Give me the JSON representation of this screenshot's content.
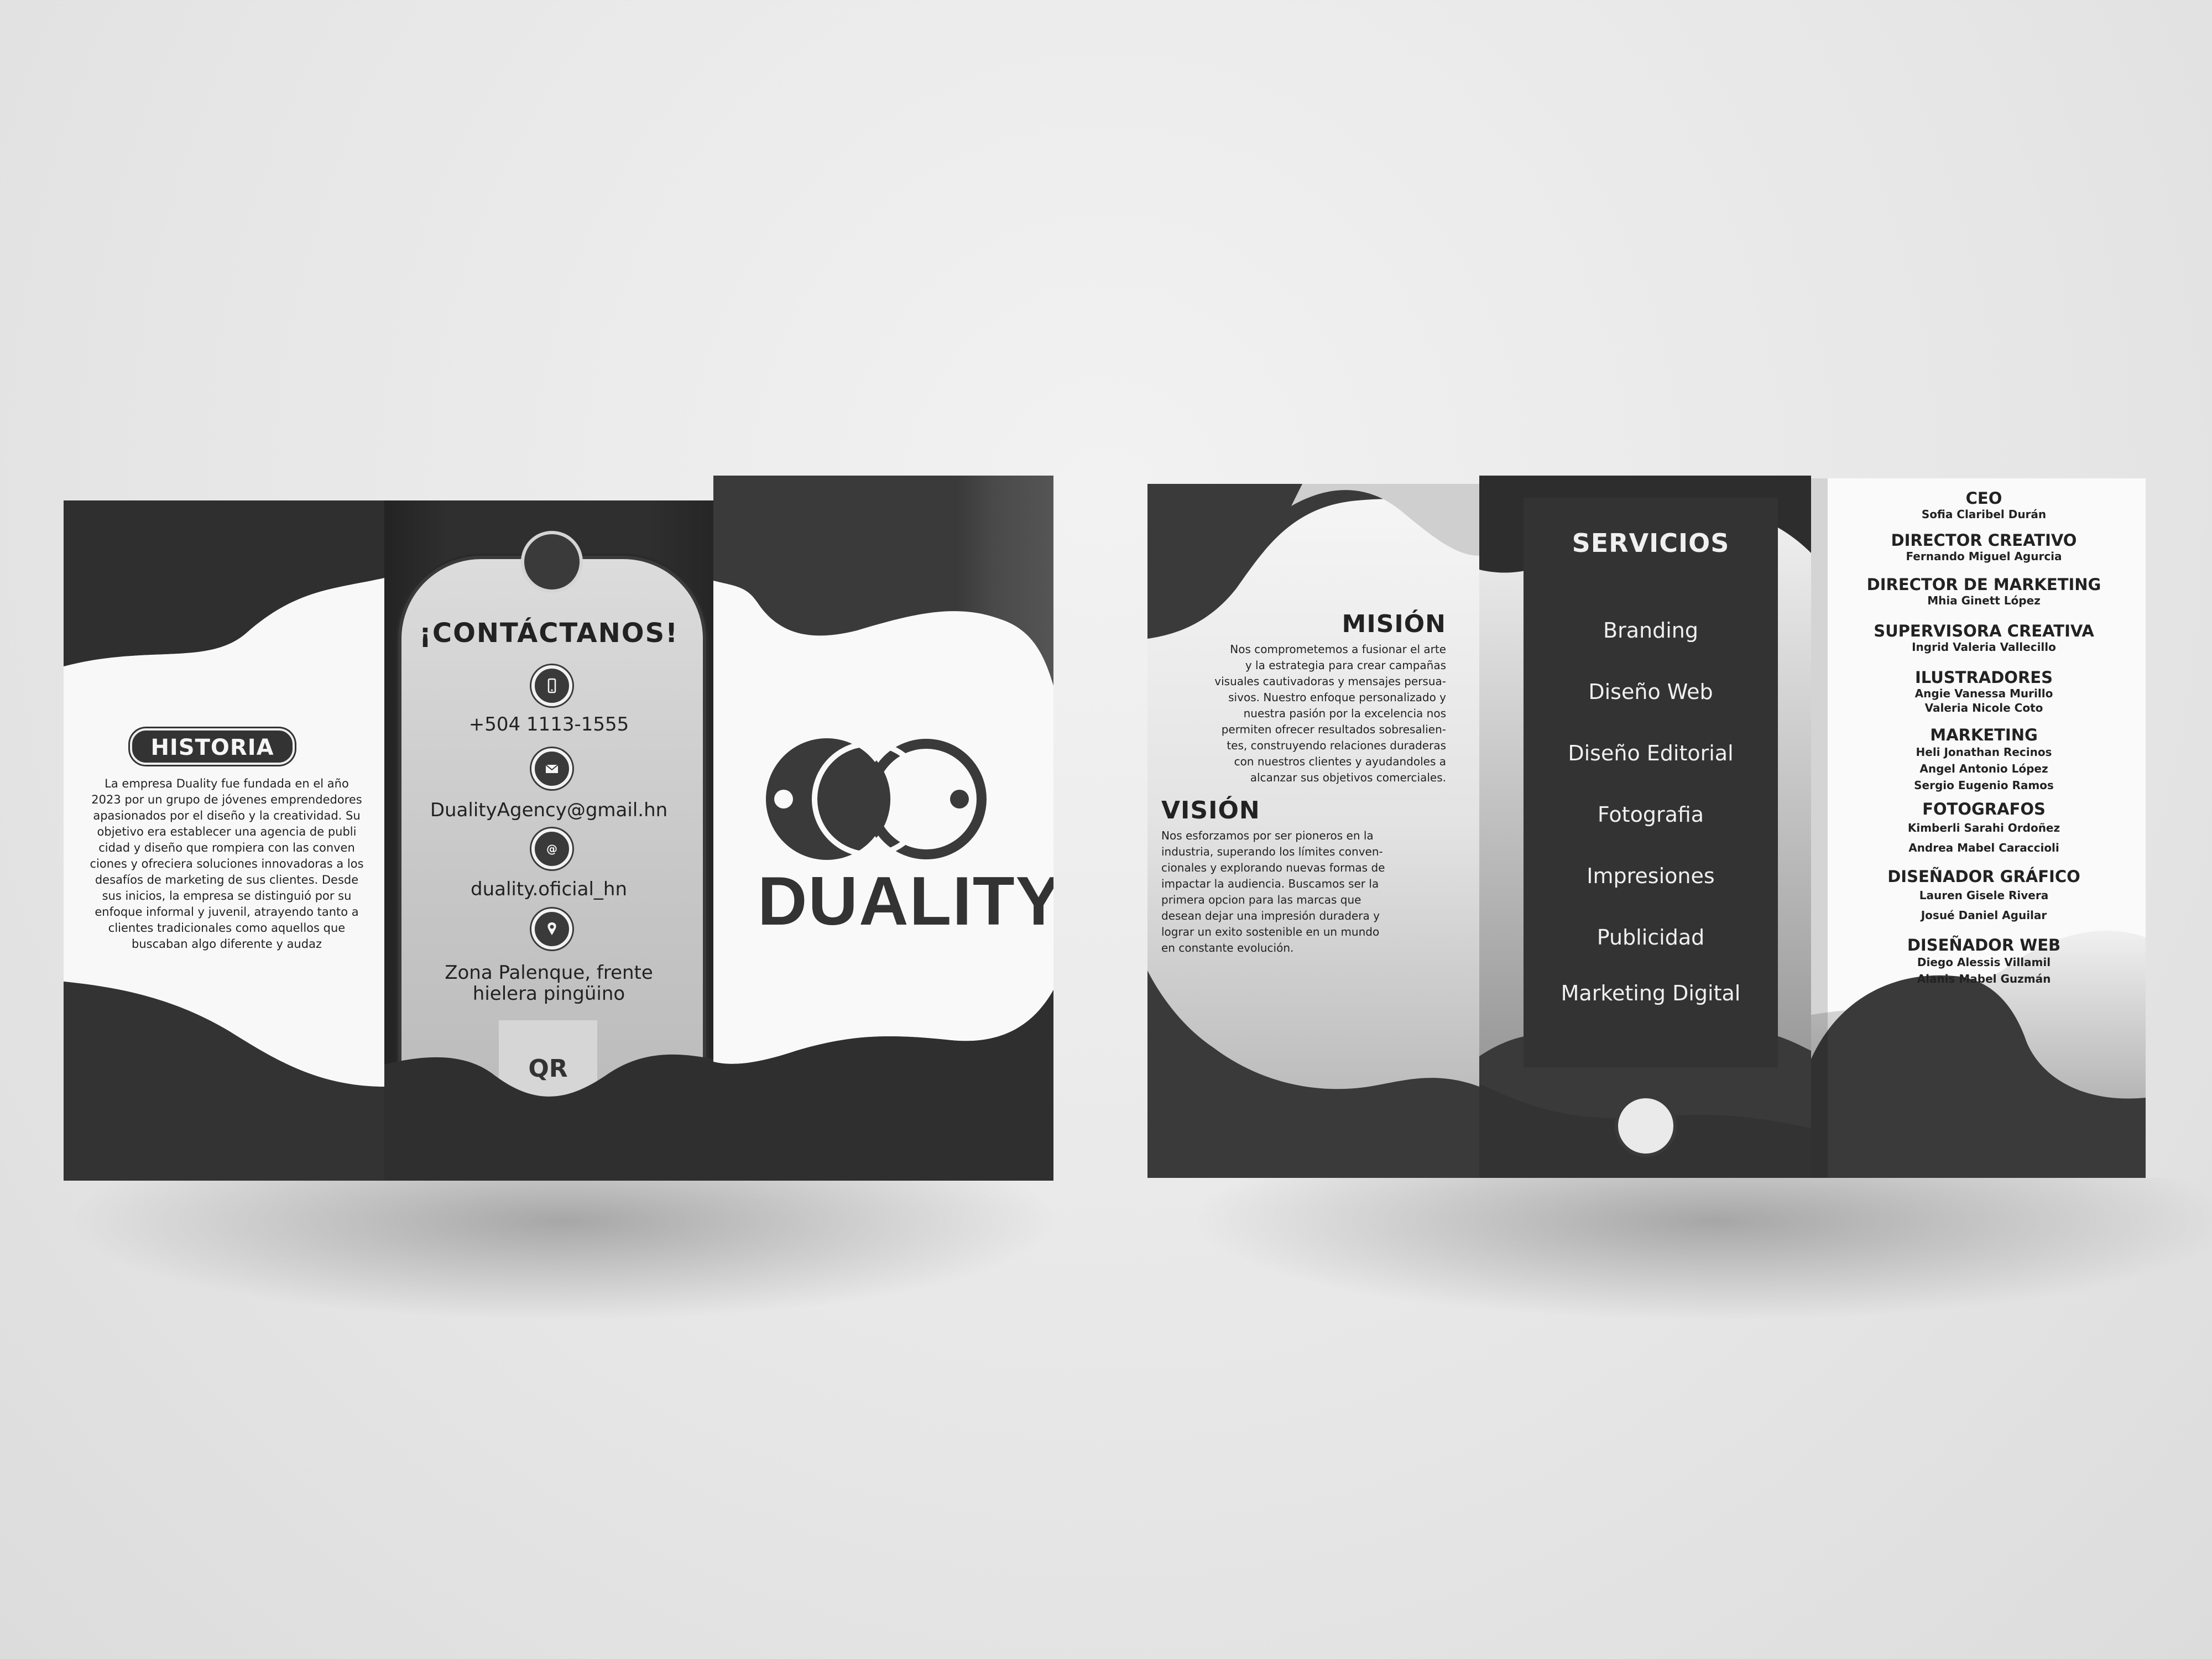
{
  "left_brochure": {
    "historia": {
      "title": "HISTORIA",
      "body_lines": [
        "La empresa Duality fue fundada en el año",
        "2023 por un grupo de jóvenes emprendedores",
        "apasionados por el diseño y la creatividad. Su",
        "objetivo era establecer una agencia de publi",
        "cidad y diseño que rompiera con las conven",
        "ciones y ofreciera soluciones innovadoras a los",
        "desafíos de marketing de sus clientes. Desde",
        "sus inicios, la empresa se distinguió por su",
        "enfoque informal y juvenil, atrayendo tanto a",
        "clientes tradicionales como aquellos que",
        "buscaban algo diferente y audaz"
      ]
    },
    "contact": {
      "title": "¡CONTÁCTANOS!",
      "phone": "+504 1113-1555",
      "email": "DualityAgency@gmail.hn",
      "social": "duality.oficial_hn",
      "address_line1": "Zona Palenque, frente",
      "address_line2": "hielera pingüino",
      "qr_label": "QR",
      "icons": [
        "phone-icon",
        "mail-icon",
        "at-icon",
        "location-pin-icon"
      ]
    },
    "brand": {
      "name": "DUALITY"
    }
  },
  "right_brochure": {
    "mision": {
      "title": "MISIÓN",
      "body_lines": [
        "Nos comprometemos a fusionar el arte",
        "y la estrategia para crear campañas",
        "visuales cautivadoras y mensajes persua-",
        "sivos. Nuestro enfoque personalizado y",
        "nuestra pasión por la excelencia nos",
        "permiten ofrecer resultados sobresalien-",
        "tes, construyendo relaciones duraderas",
        "con nuestros clientes y ayudandoles a",
        "alcanzar sus objetivos comerciales."
      ]
    },
    "vision": {
      "title": "VISIÓN",
      "body_lines": [
        "Nos esforzamos por ser pioneros en la",
        "industria, superando los límites conven-",
        "cionales y explorando nuevas formas de",
        "impactar la audiencia. Buscamos ser la",
        "primera opcion para las marcas que",
        "desean dejar una impresión duradera y",
        "lograr un exito sostenible en un mundo",
        "en constante evolución."
      ]
    },
    "servicios": {
      "title": "SERVICIOS",
      "items": [
        "Branding",
        "Diseño Web",
        "Diseño Editorial",
        "Fotografia",
        "Impresiones",
        "Publicidad",
        "Marketing Digital"
      ]
    },
    "team": [
      {
        "role": "CEO",
        "names": [
          "Sofia Claribel Durán"
        ]
      },
      {
        "role": "DIRECTOR CREATIVO",
        "names": [
          "Fernando Miguel Agurcia"
        ]
      },
      {
        "role": "DIRECTOR DE MARKETING",
        "names": [
          "Mhia Ginett López"
        ]
      },
      {
        "role": "SUPERVISORA CREATIVA",
        "names": [
          "Ingrid Valeria Vallecillo"
        ]
      },
      {
        "role": "ILUSTRADORES",
        "names": [
          "Angie Vanessa Murillo",
          "Valeria Nicole Coto"
        ]
      },
      {
        "role": "MARKETING",
        "names": [
          "Heli Jonathan Recinos",
          "Angel Antonio López",
          "Sergio Eugenio Ramos"
        ]
      },
      {
        "role": "FOTOGRAFOS",
        "names": [
          "Kimberli Sarahi Ordoñez",
          "Andrea Mabel Caraccioli"
        ]
      },
      {
        "role": "DISEÑADOR GRÁFICO",
        "names": [
          "Lauren Gisele Rivera",
          "Josué Daniel Aguilar"
        ]
      },
      {
        "role": "DISEÑADOR WEB",
        "names": [
          "Diego Alessis Villamil",
          "Alanis Mabel Guzmán"
        ]
      }
    ]
  },
  "colors": {
    "background": "#e4e4e4",
    "dark": "#3a3a3a",
    "darker": "#2e2e2e",
    "light": "#f7f7f7",
    "mid_gray": "#bdbdbd"
  }
}
